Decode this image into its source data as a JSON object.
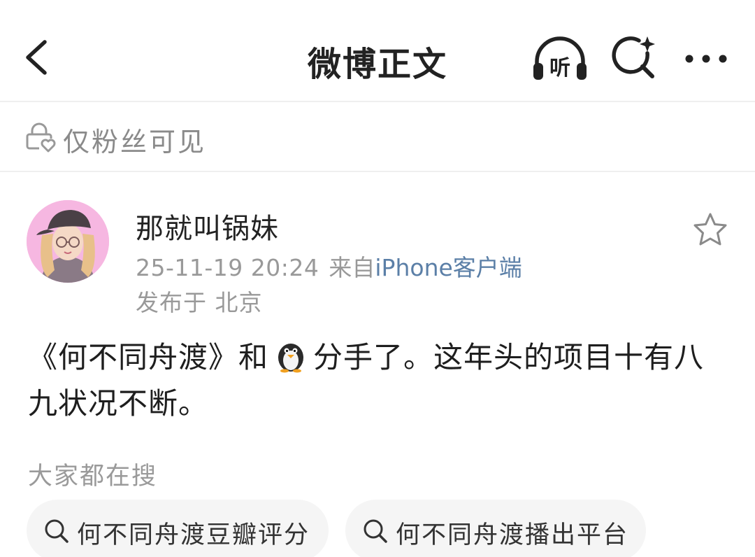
{
  "header": {
    "title": "微博正文",
    "listen_label": "听"
  },
  "visibility": {
    "text": "仅粉丝可见"
  },
  "post": {
    "author": "那就叫锅妹",
    "timestamp": "25-11-19 20:24",
    "source_prefix": "来自",
    "source_device": "iPhone客户端",
    "location": "发布于 北京",
    "body_part1": "《何不同舟渡》和",
    "body_emoji": "penguin-icon",
    "body_part2": "分手了。这年头的项目十有八九状况不断。"
  },
  "suggestions": {
    "heading": "大家都在搜",
    "items": [
      {
        "label": "何不同舟渡豆瓣评分"
      },
      {
        "label": "何不同舟渡播出平台"
      }
    ]
  },
  "colors": {
    "link_blue": "#5b7fa7",
    "muted_gray": "#999999",
    "chip_bg": "#f5f5f5",
    "avatar_bg": "#f6b7e1"
  }
}
